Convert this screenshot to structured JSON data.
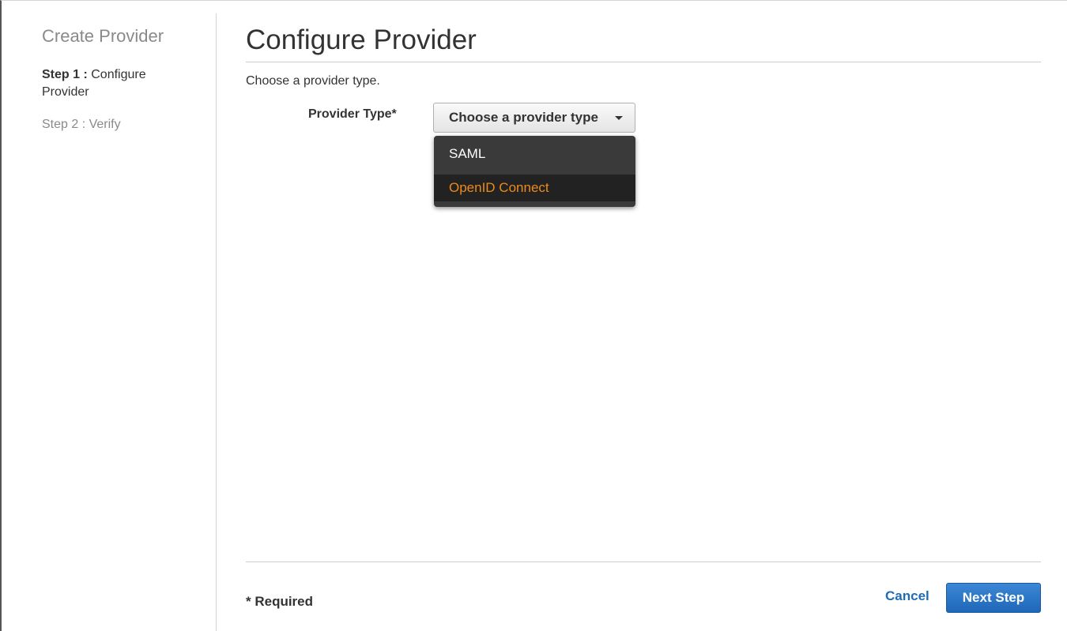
{
  "sidebar": {
    "title": "Create Provider",
    "steps": [
      {
        "prefix": "Step 1 :",
        "label": "Configure Provider"
      },
      {
        "label": "Step 2 : Verify"
      }
    ]
  },
  "main": {
    "title": "Configure Provider",
    "intro": "Choose a provider type.",
    "provider_type": {
      "label": "Provider Type*",
      "selected": "Choose a provider type",
      "options": [
        "SAML",
        "OpenID Connect"
      ],
      "highlighted_option": "OpenID Connect"
    }
  },
  "footer": {
    "required_note": "* Required",
    "cancel_label": "Cancel",
    "next_label": "Next Step"
  },
  "colors": {
    "accent_link": "#1f6cb5",
    "primary_button": "#1f67b8",
    "dropdown_bg": "#3a3a3a",
    "highlight_text": "#ec8b1c"
  }
}
